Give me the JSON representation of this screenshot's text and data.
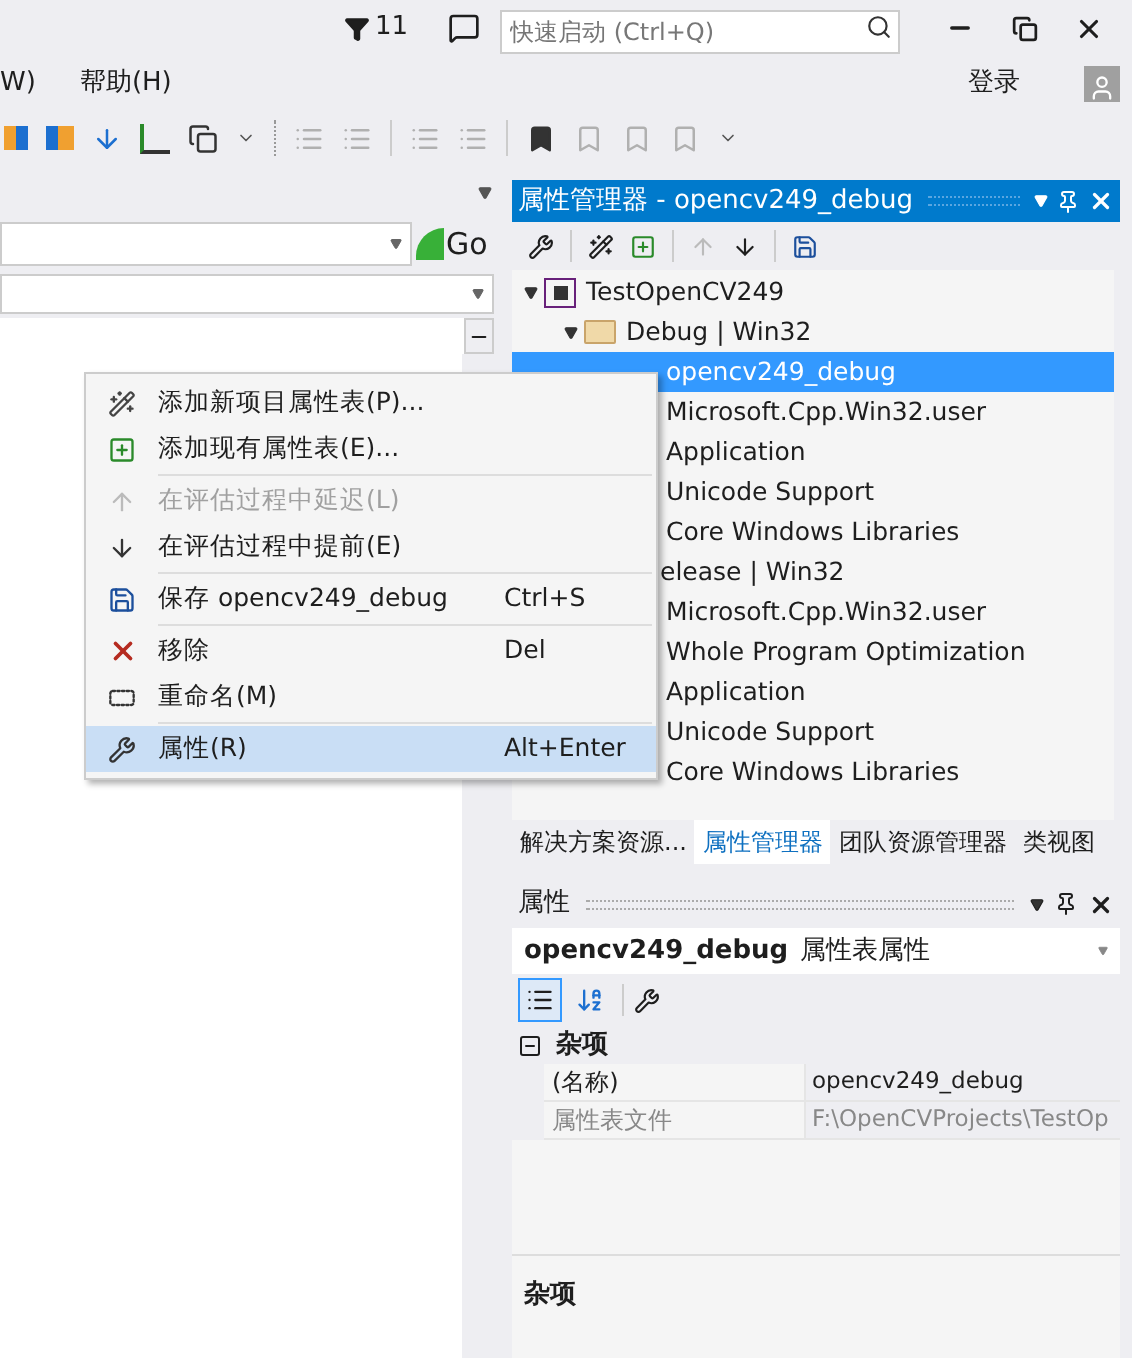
{
  "titlebar": {
    "notifications": "11",
    "quick_launch": {
      "placeholder": "快速启动 (Ctrl+Q)"
    }
  },
  "menubar": {
    "items": [
      "W)",
      "帮助(H)"
    ],
    "sign_in": "登录"
  },
  "left_pane": {
    "go_button": "Go"
  },
  "property_manager": {
    "title": "属性管理器 - opencv249_debug",
    "tree": [
      {
        "label": "TestOpenCV249",
        "kind": "project",
        "expanded": true,
        "selected": false,
        "children": [
          {
            "label": "Debug | Win32",
            "kind": "folder",
            "expanded": true,
            "selected": false,
            "children": [
              {
                "label": "opencv249_debug",
                "selected": true
              },
              {
                "label": "Microsoft.Cpp.Win32.user",
                "selected": false
              },
              {
                "label": "Application",
                "selected": false
              },
              {
                "label": "Unicode Support",
                "selected": false
              },
              {
                "label": "Core Windows Libraries",
                "selected": false
              }
            ]
          },
          {
            "label": "elease | Win32",
            "selected": false,
            "children": [
              {
                "label": "Microsoft.Cpp.Win32.user",
                "selected": false
              },
              {
                "label": "Whole Program Optimization",
                "selected": false
              },
              {
                "label": "Application",
                "selected": false
              },
              {
                "label": "Unicode Support",
                "selected": false
              },
              {
                "label": "Core Windows Libraries",
                "selected": false
              }
            ]
          }
        ]
      }
    ]
  },
  "context_menu": [
    {
      "kind": "add_new",
      "label": "添加新项目属性表(P)...",
      "disabled": false,
      "selected": false
    },
    {
      "kind": "add_existing",
      "label": "添加现有属性表(E)...",
      "disabled": false,
      "selected": false,
      "separator_after": true
    },
    {
      "kind": "up",
      "label": "在评估过程中延迟(L)",
      "disabled": true,
      "selected": false
    },
    {
      "kind": "down",
      "label": "在评估过程中提前(E)",
      "disabled": false,
      "selected": false,
      "separator_after": true
    },
    {
      "kind": "save",
      "label": "保存 opencv249_debug",
      "shortcut": "Ctrl+S",
      "disabled": false,
      "selected": false,
      "separator_after": true
    },
    {
      "kind": "remove",
      "label": "移除",
      "shortcut": "Del",
      "disabled": false,
      "selected": false
    },
    {
      "kind": "rename",
      "label": "重命名(M)",
      "disabled": false,
      "selected": false,
      "separator_after": true
    },
    {
      "kind": "properties",
      "label": "属性(R)",
      "shortcut": "Alt+Enter",
      "disabled": false,
      "selected": true
    }
  ],
  "tabs": [
    {
      "label": "解决方案资源...",
      "selected": false
    },
    {
      "label": "属性管理器",
      "selected": true
    },
    {
      "label": "团队资源管理器",
      "selected": false
    },
    {
      "label": "类视图",
      "selected": false
    }
  ],
  "properties": {
    "title": "属性",
    "object": "opencv249_debug",
    "object_type": "属性表属性",
    "sort": [
      {
        "kind": "categorized",
        "selected": true
      },
      {
        "kind": "alphabetical",
        "selected": false
      }
    ],
    "category": {
      "name": "杂项",
      "expanded": true
    },
    "rows": [
      {
        "name": "(名称)",
        "value": "opencv249_debug",
        "disabled": false
      },
      {
        "name": "属性表文件",
        "value": "F:\\OpenCVProjects\\TestOp",
        "disabled": true
      }
    ],
    "description": "杂项"
  }
}
